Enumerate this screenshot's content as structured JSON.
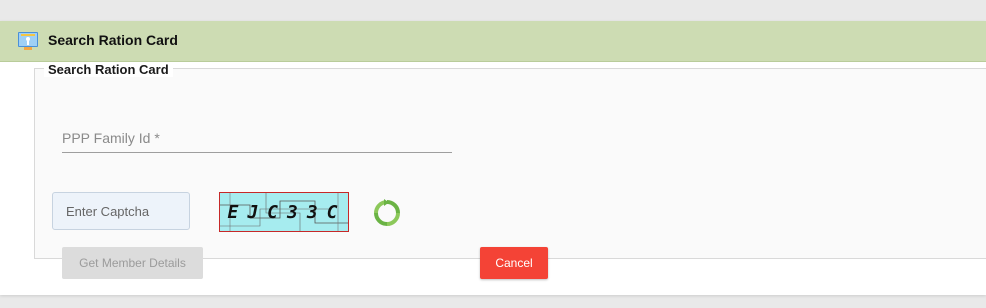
{
  "header": {
    "title": "Search Ration Card",
    "icon": "ration-card-icon"
  },
  "form": {
    "legend": "Search Ration Card",
    "family_id": {
      "placeholder": "PPP Family Id *",
      "value": ""
    },
    "captcha_input": {
      "placeholder": "Enter Captcha",
      "value": ""
    },
    "captcha_text": "EJC33C",
    "refresh_icon": "refresh-icon"
  },
  "buttons": {
    "get_member_details": "Get Member Details",
    "cancel": "Cancel"
  },
  "colors": {
    "header_bg": "#cddcb3",
    "cancel_bg": "#f44336",
    "captcha_bg": "#a6ecef",
    "refresh_green": "#6ab344"
  }
}
